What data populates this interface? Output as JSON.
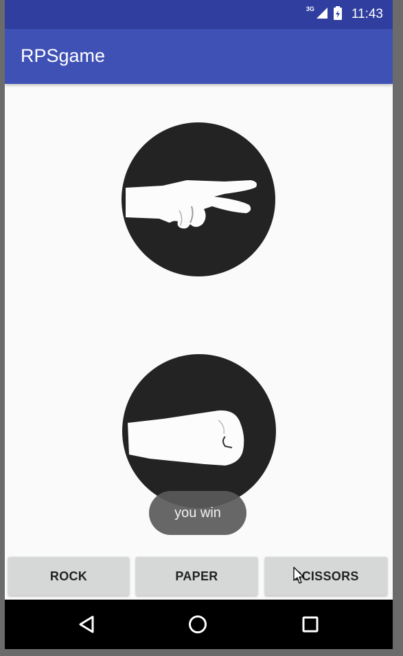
{
  "status_bar": {
    "network_type": "3G",
    "time": "11:43",
    "icons": [
      "signal-icon",
      "battery-icon"
    ]
  },
  "app_bar": {
    "title": "RPSgame"
  },
  "game": {
    "top_hand": "scissors",
    "bottom_hand": "rock"
  },
  "toast": {
    "message": "you win"
  },
  "buttons": {
    "rock": "ROCK",
    "paper": "PAPER",
    "scissors": "SCISSORS"
  },
  "nav_bar": {
    "icons": [
      "back-icon",
      "home-icon",
      "recent-apps-icon"
    ]
  },
  "colors": {
    "status_bar": "#303f9f",
    "app_bar": "#3f51b5",
    "background": "#fafafa",
    "hand_circle": "#232323",
    "button": "#d6d7d7",
    "toast": "#5a5a5a"
  }
}
